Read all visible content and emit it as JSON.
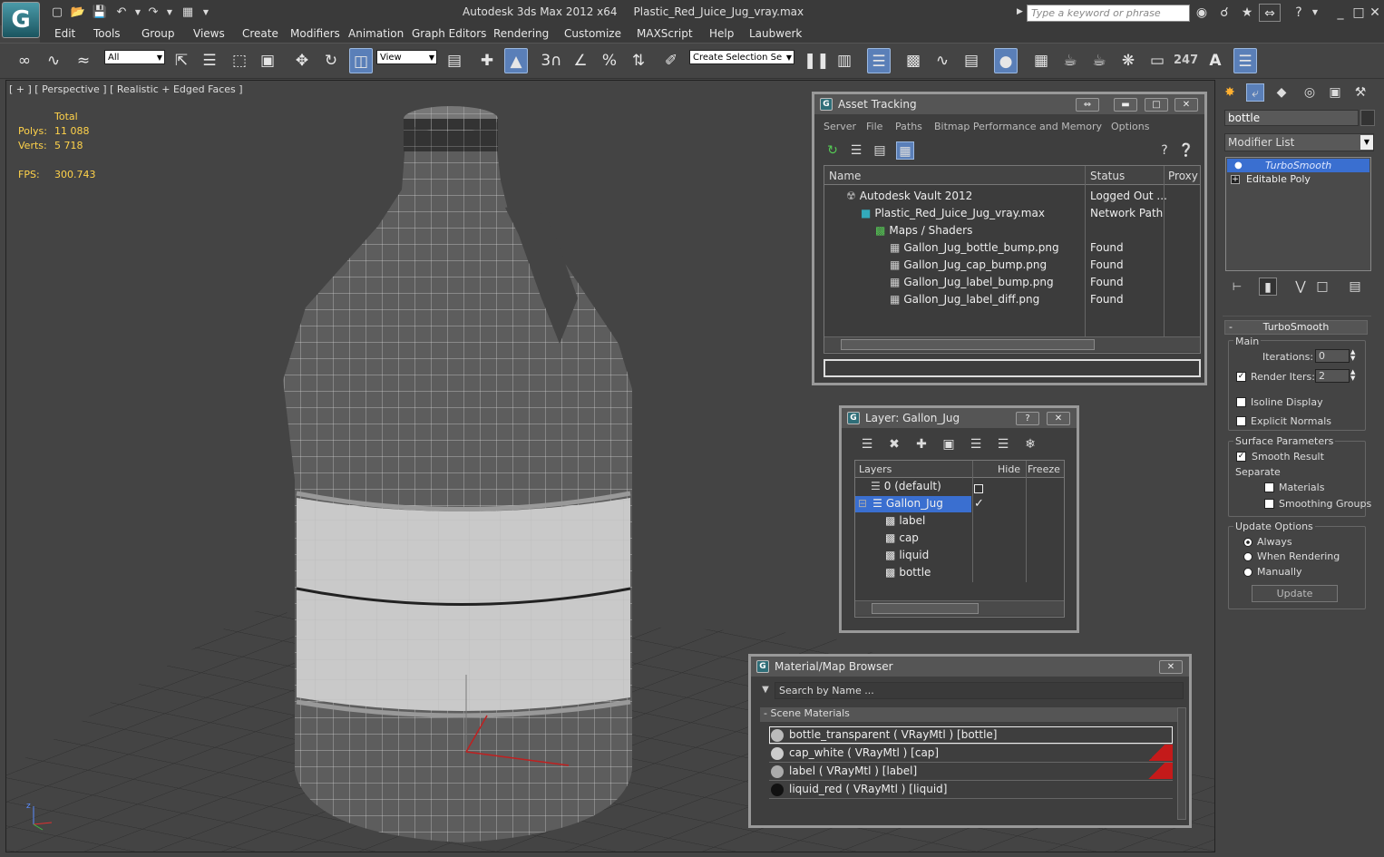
{
  "app": {
    "title": "Autodesk 3ds Max  2012 x64",
    "file": "Plastic_Red_Juice_Jug_vray.max",
    "search_placeholder": "Type a keyword or phrase"
  },
  "menu": [
    "Edit",
    "Tools",
    "Group",
    "Views",
    "Create",
    "Modifiers",
    "Animation",
    "Graph Editors",
    "Rendering",
    "Customize",
    "MAXScript",
    "Help",
    "Laubwerk"
  ],
  "toolbar": {
    "selection_filter": "All",
    "ref_coord": "View",
    "named_selection": "Create Selection Se",
    "count": "247"
  },
  "viewport": {
    "label": "[ + ] [ Perspective ] [ Realistic + Edged Faces ]",
    "stats_header": "Total",
    "polys_label": "Polys:",
    "polys": "11 088",
    "verts_label": "Verts:",
    "verts": "5 718",
    "fps_label": "FPS:",
    "fps": "300.743"
  },
  "command_panel": {
    "object_name": "bottle",
    "modifier_list": "Modifier List",
    "stack": [
      "TurboSmooth",
      "Editable Poly"
    ],
    "rollout": "TurboSmooth",
    "main": "Main",
    "iterations_label": "Iterations:",
    "iterations": "0",
    "render_iters_label": "Render Iters:",
    "render_iters": "2",
    "isoline": "Isoline Display",
    "explicit": "Explicit Normals",
    "surface": "Surface Parameters",
    "smooth_result": "Smooth Result",
    "separate": "Separate",
    "materials": "Materials",
    "smoothing_groups": "Smoothing Groups",
    "update_options": "Update Options",
    "always": "Always",
    "when_rendering": "When Rendering",
    "manually": "Manually",
    "update": "Update"
  },
  "asset_tracking": {
    "title": "Asset Tracking",
    "menu": [
      "Server",
      "File",
      "Paths",
      "Bitmap Performance and Memory",
      "Options"
    ],
    "cols": [
      "Name",
      "Status",
      "Proxy"
    ],
    "rows": [
      {
        "name": "Autodesk Vault 2012",
        "status": "Logged Out ..."
      },
      {
        "name": "Plastic_Red_Juice_Jug_vray.max",
        "status": "Network Path"
      },
      {
        "name": "Maps / Shaders",
        "status": ""
      },
      {
        "name": "Gallon_Jug_bottle_bump.png",
        "status": "Found"
      },
      {
        "name": "Gallon_Jug_cap_bump.png",
        "status": "Found"
      },
      {
        "name": "Gallon_Jug_label_bump.png",
        "status": "Found"
      },
      {
        "name": "Gallon_Jug_label_diff.png",
        "status": "Found"
      }
    ]
  },
  "layer": {
    "title": "Layer: Gallon_Jug",
    "cols": [
      "Layers",
      "Hide",
      "Freeze"
    ],
    "rows": [
      "0 (default)",
      "Gallon_Jug",
      "label",
      "cap",
      "liquid",
      "bottle"
    ]
  },
  "material": {
    "title": "Material/Map Browser",
    "search": "Search by Name ...",
    "group": "- Scene Materials",
    "items": [
      "bottle_transparent  ( VRayMtl )  [bottle]",
      "cap_white  ( VRayMtl )  [cap]",
      "label  ( VRayMtl )  [label]",
      "liquid_red  ( VRayMtl )  [liquid]"
    ]
  },
  "colors": {
    "accent": "#3a6fd0",
    "stat": "#ffd24a",
    "swatch_red": "#c41a1a"
  }
}
